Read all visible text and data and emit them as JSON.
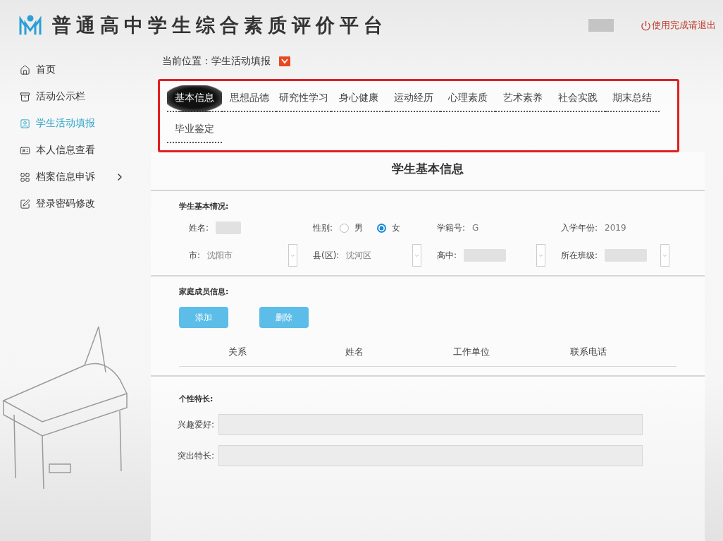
{
  "header": {
    "title": "普通高中学生综合素质评价平台",
    "logout": "使用完成请退出"
  },
  "sidebar": {
    "items": [
      {
        "label": "首页",
        "kind": "home",
        "selected": false,
        "has_submenu": false
      },
      {
        "label": "活动公示栏",
        "kind": "board",
        "selected": false,
        "has_submenu": false
      },
      {
        "label": "学生活动填报",
        "kind": "person",
        "selected": true,
        "has_submenu": false
      },
      {
        "label": "本人信息查看",
        "kind": "card",
        "selected": false,
        "has_submenu": false
      },
      {
        "label": "档案信息申诉",
        "kind": "grid",
        "selected": false,
        "has_submenu": true
      },
      {
        "label": "登录密码修改",
        "kind": "edit",
        "selected": false,
        "has_submenu": false
      }
    ]
  },
  "breadcrumb": "当前位置：学生活动填报",
  "tabs": [
    {
      "label": "基本信息",
      "selected": true
    },
    {
      "label": "思想品德",
      "selected": false
    },
    {
      "label": "研究性学习",
      "selected": false
    },
    {
      "label": "身心健康",
      "selected": false
    },
    {
      "label": "运动经历",
      "selected": false
    },
    {
      "label": "心理素质",
      "selected": false
    },
    {
      "label": "艺术素养",
      "selected": false
    },
    {
      "label": "社会实践",
      "selected": false
    },
    {
      "label": "期末总结",
      "selected": false
    },
    {
      "label": "毕业鉴定",
      "selected": false
    }
  ],
  "form": {
    "title": "学生基本信息",
    "basic": {
      "heading": "学生基本情况:",
      "fields": [
        {
          "kind": "text",
          "label": "姓名:",
          "redacted": true
        },
        {
          "kind": "radio",
          "label": "性别:",
          "options": [
            {
              "label": "男",
              "selected": false
            },
            {
              "label": "女",
              "selected": true
            }
          ]
        },
        {
          "kind": "text",
          "label": "学籍号:",
          "value": "G",
          "redacted": false
        },
        {
          "kind": "text",
          "label": "入学年份:",
          "value": "2019",
          "redacted": false
        }
      ],
      "selects": [
        {
          "label": "市:",
          "value": "沈阳市",
          "redacted": false
        },
        {
          "label": "县(区):",
          "value": "沈河区",
          "redacted": false
        },
        {
          "label": "高中:",
          "redacted": true
        },
        {
          "label": "所在班级:",
          "redacted": true
        }
      ]
    },
    "family": {
      "heading": "家庭成员信息:",
      "buttons": [
        "添加",
        "删除"
      ],
      "columns": [
        "关系",
        "姓名",
        "工作单位",
        "联系电话"
      ]
    },
    "traits": {
      "heading": "个性特长:",
      "fields": [
        {
          "label": "兴趣爱好:"
        },
        {
          "label": "突出特长:"
        }
      ]
    }
  }
}
